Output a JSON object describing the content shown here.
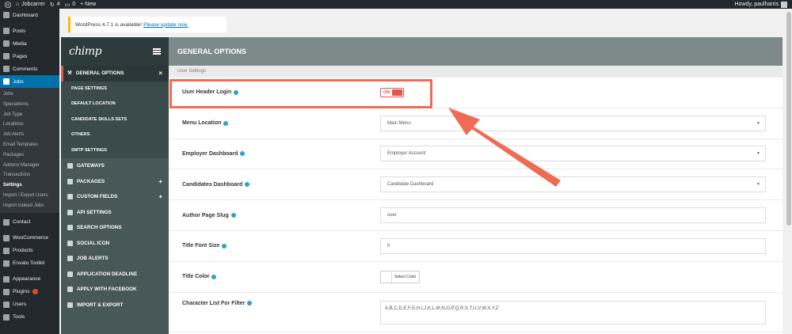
{
  "adminbar": {
    "site_name": "Jobcarrer",
    "updates_count": "4",
    "comments_count": "0",
    "new_label": "+ New",
    "howdy": "Howdy, paulharris"
  },
  "wp_menu": {
    "items_top": [
      {
        "label": "Dashboard",
        "icon": "dashboard-icon"
      },
      {
        "label": "Posts",
        "icon": "pin-icon"
      },
      {
        "label": "Media",
        "icon": "media-icon"
      },
      {
        "label": "Pages",
        "icon": "pages-icon"
      },
      {
        "label": "Comments",
        "icon": "comments-icon"
      },
      {
        "label": "Jobs",
        "icon": "pin-icon"
      }
    ],
    "jobs_sub": [
      "Jobs",
      "Specialisms",
      "Job Type",
      "Locations",
      "Job Alerts",
      "Email Templates",
      "Packages",
      "Addons Manager",
      "Transactions",
      "Settings",
      "Import / Export Users",
      "Import Indeed Jobs"
    ],
    "items_bottom": [
      {
        "label": "Contact",
        "icon": "mail-icon"
      },
      {
        "label": "WooCommerce",
        "icon": "woocommerce-icon"
      },
      {
        "label": "Products",
        "icon": "products-icon"
      },
      {
        "label": "Envato Toolkit",
        "icon": "envato-icon"
      },
      {
        "label": "Appearance",
        "icon": "appearance-icon"
      },
      {
        "label": "Plugins",
        "icon": "plugins-icon"
      },
      {
        "label": "Users",
        "icon": "users-icon"
      },
      {
        "label": "Tools",
        "icon": "tools-icon"
      }
    ]
  },
  "notice": {
    "text": "WordPress 4.7.1 is available!",
    "link": "Please update now."
  },
  "panel": {
    "logo": "chimp",
    "title": "GENERAL OPTIONS",
    "nav_open": "GENERAL OPTIONS",
    "nav_open_close": "×",
    "subnav": [
      "PAGE SETTINGS",
      "DEFAULT LOCATION",
      "CANDIDATE SKILLS SETS",
      "OTHERS",
      "SMTP SETTINGS"
    ],
    "nav": [
      {
        "label": "GATEWAYS",
        "plus": ""
      },
      {
        "label": "PACKAGES",
        "plus": "+"
      },
      {
        "label": "CUSTOM FIELDS",
        "plus": "+"
      },
      {
        "label": "API SETTINGS",
        "plus": ""
      },
      {
        "label": "SEARCH OPTIONS",
        "plus": ""
      },
      {
        "label": "SOCIAL ICON",
        "plus": ""
      },
      {
        "label": "JOB ALERTS",
        "plus": ""
      },
      {
        "label": "APPLICATION DEADLINE",
        "plus": ""
      },
      {
        "label": "APPLY WITH FACEBOOK",
        "plus": ""
      },
      {
        "label": "IMPORT & EXPORT",
        "plus": ""
      }
    ]
  },
  "content": {
    "section": "User Settings",
    "user_header_login": {
      "label": "User Header Login",
      "toggle": "ON"
    },
    "menu_location": {
      "label": "Menu Location",
      "value": "Main Menu"
    },
    "employer_dashboard": {
      "label": "Employer Dashboard",
      "value": "Employer Account"
    },
    "candidates_dashboard": {
      "label": "Candidates Dashboard",
      "value": "Candidate Dashboard"
    },
    "author_page_slug": {
      "label": "Author Page Slug",
      "value": "user"
    },
    "title_font_size": {
      "label": "Title Font Size",
      "value": "0"
    },
    "title_color": {
      "label": "Title Color",
      "button": "Select Color"
    },
    "char_list": {
      "label": "Character List For Filter",
      "value": "A,B,C,D,E,F,G,H,I,J,K,L,M,N,O,P,Q,R,S,T,U,V,W,X,Y,Z"
    }
  },
  "colors": {
    "accent": "#e5534b",
    "annotation": "#ef6b54",
    "wp_blue": "#0073aa"
  }
}
